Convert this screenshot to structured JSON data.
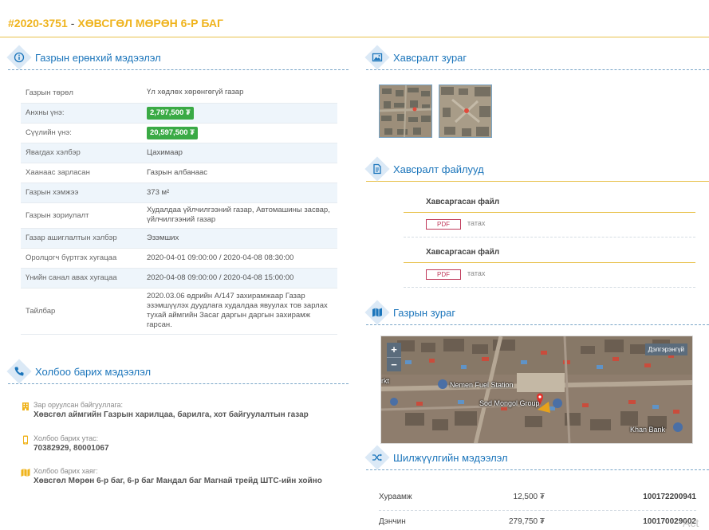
{
  "header": {
    "code": "#2020-3751",
    "separator": "-",
    "title": "ХӨВСГӨЛ МӨРӨН 6-Р БАГ"
  },
  "sections": {
    "general": "Газрын ерөнхий мэдээлэл",
    "contact": "Холбоо барих мэдээлэл",
    "images": "Хавсралт зураг",
    "files": "Хавсралт файлууд",
    "map": "Газрын зураг",
    "transfer": "Шилжүүлгийн мэдээлэл"
  },
  "info_rows": [
    {
      "label": "Газрын төрөл",
      "value": "Үл хөдлөх хөрөнгөгүй газар"
    },
    {
      "label": "Анхны үнэ:",
      "value": "2,797,500 ₮"
    },
    {
      "label": "Сүүлийн үнэ:",
      "value": "20,597,500 ₮"
    },
    {
      "label": "Явагдах хэлбэр",
      "value": "Цахимаар"
    },
    {
      "label": "Хаанаас зарласан",
      "value": "Газрын албанаас"
    },
    {
      "label": "Газрын хэмжээ",
      "value": "373 м²"
    },
    {
      "label": "Газрын зориулалт",
      "value": "Худалдаа үйлчилгээний газар, Автомашины засвар, үйлчилгээний газар"
    },
    {
      "label": "Газар ашиглалтын хэлбэр",
      "value": "Эзэмших"
    },
    {
      "label": "Оролцогч бүртгэх хугацаа",
      "value": "2020-04-01 09:00:00 / 2020-04-08 08:30:00"
    },
    {
      "label": "Үнийн санал авах хугацаа",
      "value": "2020-04-08 09:00:00 / 2020-04-08 15:00:00"
    },
    {
      "label": "Тайлбар",
      "value": "2020.03.06 өдрийн А/147 захирамжаар Газар эзэмшүүлэх дуудлага худалдаа явуулах тов зарлах тухай аймгийн Засаг даргын даргын захирамж гарсан."
    }
  ],
  "contact": {
    "org_label": "Зар оруулсан байгууллага:",
    "org_value": "Хөвсгөл аймгийн Газрын харилцаа, барилга, хот байгуулалтын газар",
    "phone_label": "Холбоо барих утас:",
    "phone_value": "70382929, 80001067",
    "address_label": "Холбоо барих хаяг:",
    "address_value": "Хөвсгөл Мөрөн 6-р баг, 6-р баг Мандал баг Магнай трейд ШТС-ийн хойно"
  },
  "files": [
    {
      "title": "Хавсаргасан файл",
      "badge": "PDF",
      "action": "татах"
    },
    {
      "title": "Хавсаргасан файл",
      "badge": "PDF",
      "action": "татах"
    }
  ],
  "map": {
    "zoom_in": "+",
    "zoom_out": "−",
    "fullscreen": "Дэлгэрэнгүй",
    "labels": {
      "fuel": "Nemen Fuel Station",
      "sod": "Sod Mongol Group",
      "khan": "Khan Bank",
      "left": "rkt"
    }
  },
  "transfers": [
    {
      "name": "Хураамж",
      "amount": "12,500 ₮",
      "account": "100172200941"
    },
    {
      "name": "Дэнчин",
      "amount": "279,750 ₮",
      "account": "100170029002"
    }
  ],
  "watermark": "Act",
  "colors": {
    "accent": "#efb31c",
    "blue": "#1b75bb",
    "price": "#3aaa45",
    "pdf": "#c0395a"
  }
}
